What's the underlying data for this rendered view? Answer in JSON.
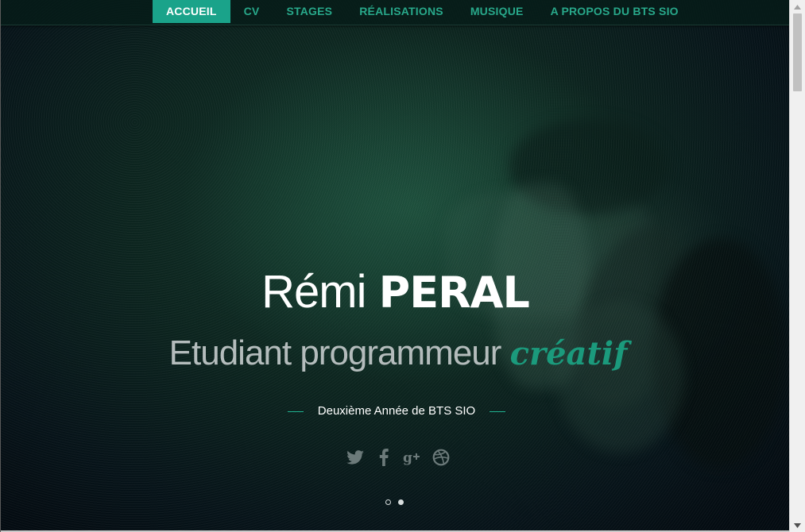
{
  "nav": {
    "items": [
      {
        "label": "ACCUEIL",
        "active": true
      },
      {
        "label": "CV",
        "active": false
      },
      {
        "label": "STAGES",
        "active": false
      },
      {
        "label": "RÉALISATIONS",
        "active": false
      },
      {
        "label": "MUSIQUE",
        "active": false
      },
      {
        "label": "A PROPOS DU BTS SIO",
        "active": false
      }
    ]
  },
  "hero": {
    "first_name": "Rémi",
    "last_name": "PERAL",
    "tagline_main": "Etudiant programmeur",
    "tagline_accent": "créatif",
    "subline": "Deuxième Année de BTS SIO",
    "social_icons": [
      "twitter-icon",
      "facebook-icon",
      "google-plus-icon",
      "dribbble-icon"
    ],
    "slides": [
      {
        "state": "empty"
      },
      {
        "state": "filled"
      }
    ]
  },
  "colors": {
    "accent": "#1aa38a",
    "nav_text": "#28a88a",
    "tagline": "#b4bcbc",
    "social_icon": "#6c7a7a",
    "background": "#0d2620"
  }
}
